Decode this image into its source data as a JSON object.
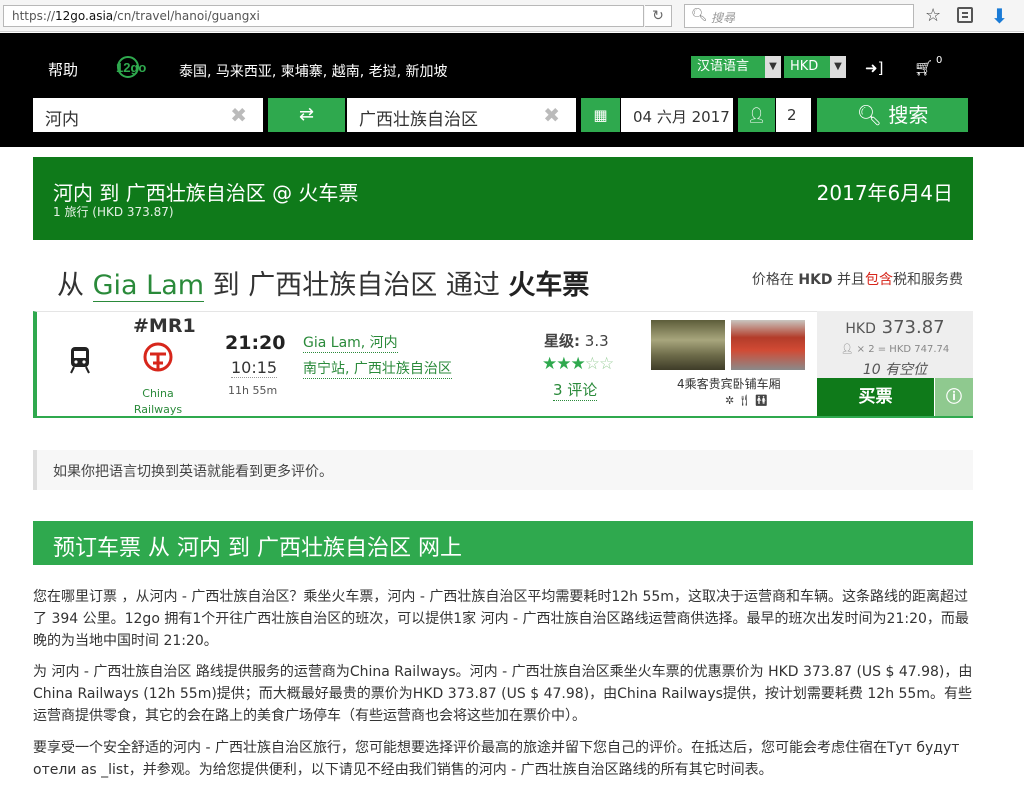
{
  "browser": {
    "url_prefix": "https://",
    "url_host": "12go.asia",
    "url_path": "/cn/travel/hanoi/guangxi",
    "search_placeholder": "搜尋"
  },
  "header": {
    "help": "帮助",
    "logo": "12go",
    "countries": "泰国, 马来西亚, 柬埔寨, 越南, 老挝, 新加坡",
    "language": "汉语语言",
    "currency": "HKD",
    "cart_count": "0"
  },
  "search": {
    "from": "河内",
    "to": "广西壮族自治区",
    "date": "04 六月 2017",
    "passengers": "2",
    "button": "搜索"
  },
  "banner": {
    "title": "河内 到 广西壮族自治区 @ 火车票",
    "subtitle": "1 旅行 (HKD 373.87)",
    "date": "2017年6月4日"
  },
  "route": {
    "from_word": "从",
    "station": "Gia Lam",
    "to_word": "到",
    "dest": "广西壮族自治区",
    "via_word": "通过",
    "mode": "火车票",
    "price_note_a": "价格在",
    "price_note_cur": "HKD",
    "price_note_b": "并且",
    "price_note_red": "包含",
    "price_note_c": "税和服务费"
  },
  "trip": {
    "number": "#MR1",
    "operator": "China Railways",
    "departure": "21:20",
    "arrival": "10:15",
    "duration": "11h 55m",
    "from_station": "Gia Lam, 河内",
    "to_station": "南宁站, 广西壮族自治区",
    "rating_label": "星级:",
    "rating": "3.3",
    "rating_value": 3.3,
    "rating_max": 5,
    "reviews": "3 评论",
    "class_name": "4乘客贵宾卧铺车厢",
    "price_currency": "HKD",
    "price": "373.87",
    "price_total": "× 2 = HKD 747.74",
    "seats": "10 有空位",
    "buy": "买票"
  },
  "notice": "如果你把语言切换到英语就能看到更多评价。",
  "section_title": "预订车票 从 河内 到 广西壮族自治区 网上",
  "paragraphs": {
    "p1": "您在哪里订票 ，从河内 - 广西壮族自治区？乘坐火车票，河内 - 广西壮族自治区平均需要耗时12h 55m，这取决于运营商和车辆。这条路线的距离超过了 394 公里。12go 拥有1个开往广西壮族自治区的班次，可以提供1家 河内 - 广西壮族自治区路线运营商供选择。最早的班次出发时间为21:20，而最晚的为当地中国时间 21:20。",
    "p2": "为 河内 - 广西壮族自治区 路线提供服务的运营商为China Railways。河内 - 广西壮族自治区乘坐火车票的优惠票价为 HKD 373.87 (US $ 47.98)，由China Railways (12h 55m)提供；而大概最好最贵的票价为HKD 373.87 (US $ 47.98)，由China Railways提供，按计划需要耗费 12h 55m。有些运营商提供零食，其它的会在路上的美食广场停车（有些运营商也会将这些加在票价中）。",
    "p3": "要享受一个安全舒适的河内 - 广西壮族自治区旅行，您可能想要选择评价最高的旅途并留下您自己的评价。在抵达后，您可能会考虑住宿在Тут будут отели as _list，并参观。为给您提供便利，以下请见不经由我们销售的河内 - 广西壮族自治区路线的所有其它时间表。"
  },
  "colors": {
    "brand_green": "#2fa94e",
    "dark_green": "#0f7a1a",
    "accent_red": "#d7261b"
  }
}
